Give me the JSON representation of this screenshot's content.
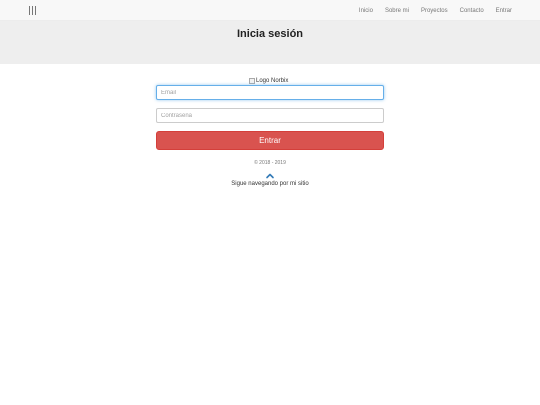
{
  "navbar": {
    "menu_icon": "vertical-lines-icon",
    "links": [
      {
        "label": "Inicio"
      },
      {
        "label": "Sobre mi"
      },
      {
        "label": "Proyectos"
      },
      {
        "label": "Contacto"
      },
      {
        "label": "Entrar"
      }
    ]
  },
  "hero": {
    "title": "Inicia sesión"
  },
  "login": {
    "logo_alt": "Logo Norbix",
    "email_placeholder": "Email",
    "email_value": "",
    "password_placeholder": "Contraseña",
    "password_value": "",
    "submit_label": "Entrar",
    "submit_color": "#d9534f"
  },
  "footer": {
    "copyright": "© 2018 - 2019",
    "scroll_icon": "chevron-up-icon",
    "continue_label": "Sigue navegando por mi sitio",
    "accent_color": "#337ab7"
  }
}
